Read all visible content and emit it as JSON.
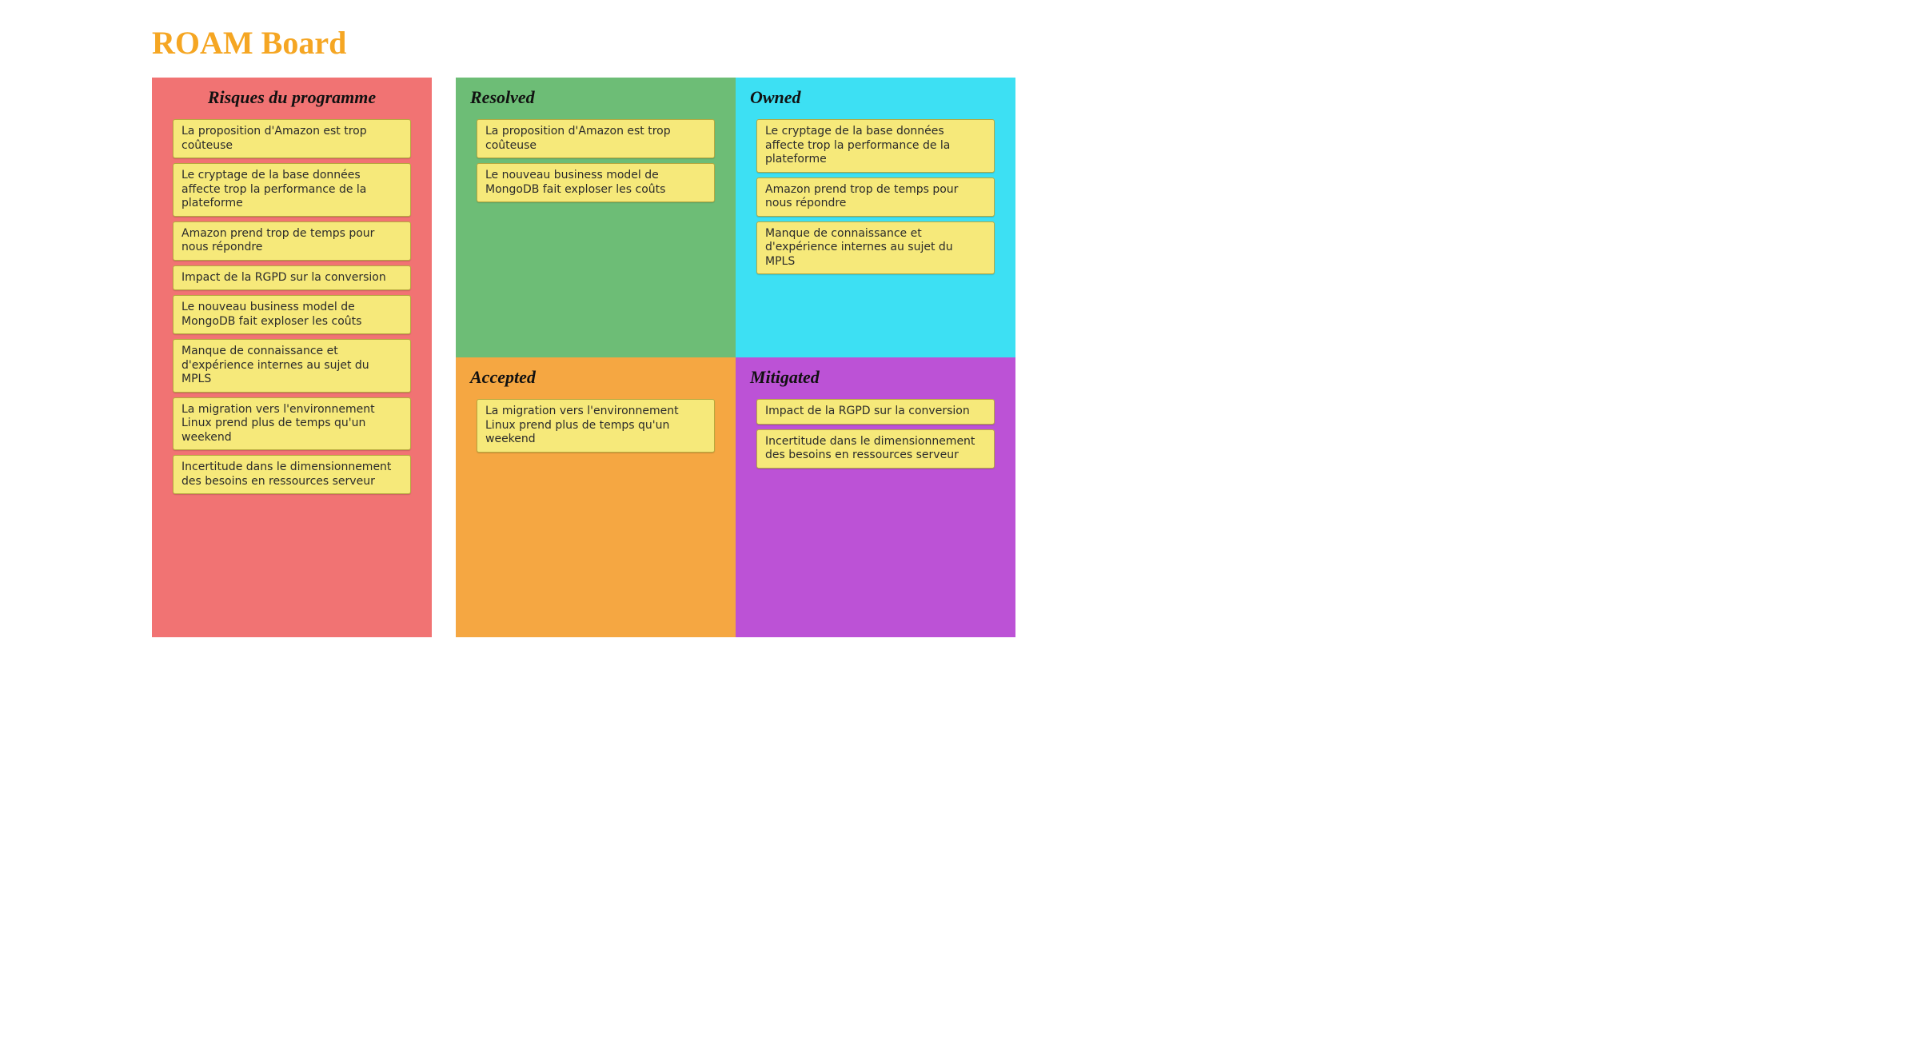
{
  "title": "ROAM Board",
  "columns": {
    "risques": {
      "header": "Risques du programme",
      "cards": [
        "La proposition d'Amazon est trop coûteuse",
        "Le cryptage de la base données affecte trop la performance de la plateforme",
        "Amazon prend trop de temps pour nous répondre",
        "Impact de la RGPD sur la conversion",
        "Le nouveau business model de MongoDB fait exploser les coûts",
        "Manque de connaissance et d'expérience internes au sujet du MPLS",
        "La migration vers l'environnement Linux prend plus de temps qu'un weekend",
        "Incertitude dans le dimensionnement des besoins en ressources serveur"
      ]
    },
    "resolved": {
      "header": "Resolved",
      "cards": [
        "La proposition d'Amazon est trop coûteuse",
        "Le nouveau business model de MongoDB fait exploser les coûts"
      ]
    },
    "owned": {
      "header": "Owned",
      "cards": [
        "Le cryptage de la base données affecte trop la performance de la plateforme",
        "Amazon prend trop de temps pour nous répondre",
        "Manque de connaissance et d'expérience internes au sujet du MPLS"
      ]
    },
    "accepted": {
      "header": "Accepted",
      "cards": [
        "La migration vers l'environnement Linux prend plus de temps qu'un weekend"
      ]
    },
    "mitigated": {
      "header": "Mitigated",
      "cards": [
        "Impact de la RGPD sur la conversion",
        "Incertitude dans le dimensionnement des besoins en ressources serveur"
      ]
    }
  }
}
